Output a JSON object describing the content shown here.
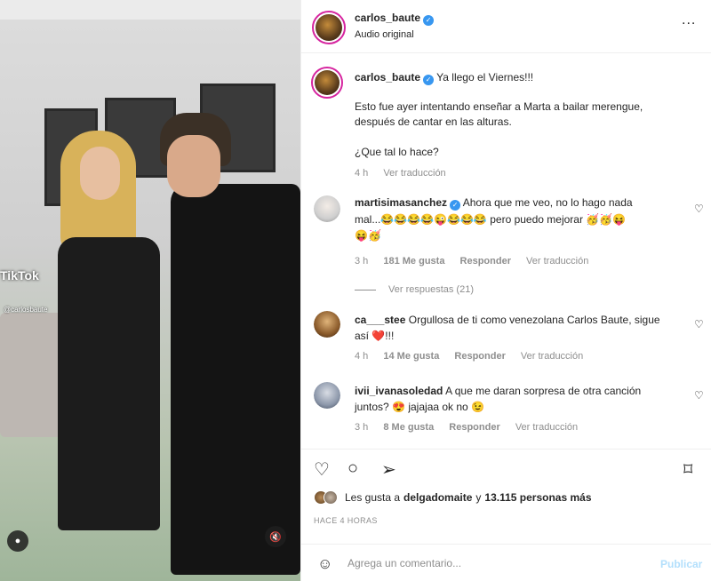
{
  "media": {
    "watermark": "TikTok",
    "handle": "@carlosbaute"
  },
  "header": {
    "username": "carlos_baute",
    "subtitle": "Audio original",
    "more": "..."
  },
  "caption": {
    "username": "carlos_baute",
    "title": "Ya llego el Viernes!!!",
    "line1": "Esto fue ayer intentando enseñar a Marta a bailar merengue,",
    "line2": "después de cantar en las alturas.",
    "line3": "¿Que tal lo hace?",
    "time": "4 h",
    "translate": "Ver traducción"
  },
  "comments": [
    {
      "username": "martisimasanchez",
      "text1": "Ahora que me veo, no lo hago nada",
      "text2_prefix": "mal...",
      "emojis_a": "😂😂😂😂😜😂😂😂",
      "text2_suffix": "pero puedo mejorar",
      "emojis_b": "🥳🥳😝",
      "emojis_c": "😝🥳",
      "time": "3 h",
      "likes": "181 Me gusta",
      "reply": "Responder",
      "translate": "Ver traducción",
      "view_replies": "Ver respuestas (21)"
    },
    {
      "username": "ca___stee",
      "text1": "Orgullosa de ti como venezolana Carlos Baute, sigue",
      "text2": "así ❤️!!!",
      "time": "4 h",
      "likes": "14 Me gusta",
      "reply": "Responder",
      "translate": "Ver traducción"
    },
    {
      "username": "ivii_ivanasoledad",
      "text1": "A que me daran sorpresa de otra canción",
      "text2_prefix": "juntos?",
      "emoji_a": "😍",
      "text2_mid": "jajajaa ok no",
      "emoji_b": "😉",
      "time": "3 h",
      "likes": "8 Me gusta",
      "reply": "Responder",
      "translate": "Ver traducción"
    }
  ],
  "likes_line": {
    "prefix": "Les gusta a",
    "user": "delgadomaite",
    "mid": "y",
    "count": "13.115 personas más"
  },
  "timestamp": "HACE 4 HORAS",
  "comment_input": {
    "placeholder": "Agrega un comentario...",
    "publish": "Publicar"
  },
  "icons": [
    "heart-icon",
    "comment-icon",
    "share-icon",
    "bookmark-icon",
    "smile-icon",
    "verified-icon",
    "user-icon",
    "mute-icon"
  ],
  "colors": {
    "verified": "#3897f0",
    "muted": "#8e8e8e",
    "publish": "#b2dffc",
    "story_ring": "#d6249f"
  }
}
